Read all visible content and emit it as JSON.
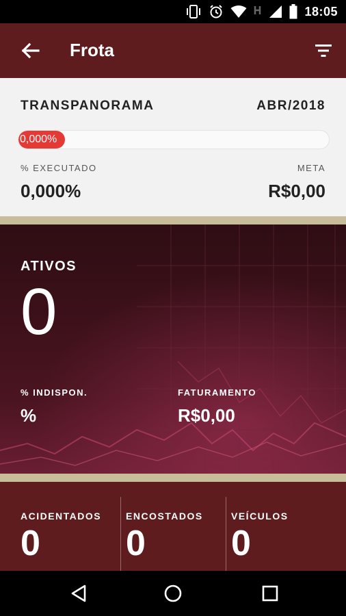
{
  "status_bar": {
    "time": "18:05",
    "icons": [
      "vibrate-icon",
      "alarm-icon",
      "wifi-icon",
      "signal-icon",
      "battery-icon"
    ]
  },
  "app_bar": {
    "title": "Frota",
    "back_icon": "arrow-left-icon",
    "filter_icon": "filter-icon"
  },
  "summary": {
    "company": "TRANSPANORAMA",
    "period": "ABR/2018",
    "progress_label": "0,000%",
    "progress_fraction": 0,
    "executed_label": "% EXECUTADO",
    "executed_value": "0,000%",
    "meta_label": "META",
    "meta_value": "R$0,00"
  },
  "fleet": {
    "active_label": "ATIVOS",
    "active_value": "0",
    "unavailable_label": "% INDISPON.",
    "unavailable_value": "%",
    "billing_label": "FATURAMENTO",
    "billing_value": "R$0,00"
  },
  "stats": [
    {
      "label": "ACIDENTADOS",
      "value": "0"
    },
    {
      "label": "ENCOSTADOS",
      "value": "0"
    },
    {
      "label": "VEÍCULOS",
      "value": "0"
    }
  ],
  "nav_bar": {
    "icons": [
      "back-triangle-icon",
      "home-circle-icon",
      "recents-square-icon"
    ]
  },
  "colors": {
    "app_bar": "#5e1c1f",
    "progress_fill": "#e53935",
    "gold_divider": "#c7bd9b",
    "hero_background": "#3f1219"
  }
}
